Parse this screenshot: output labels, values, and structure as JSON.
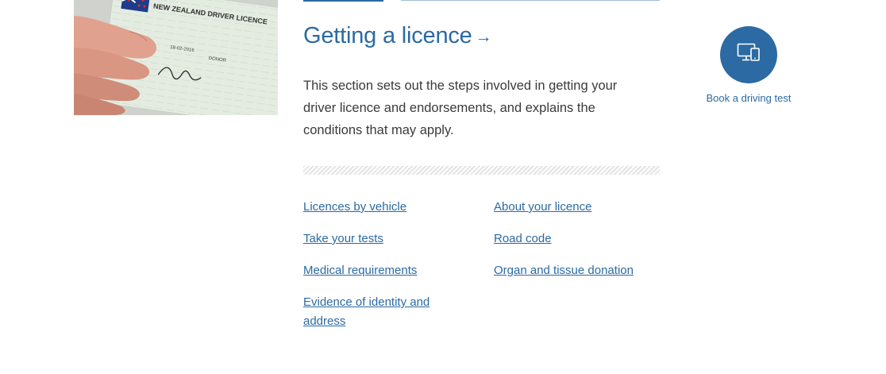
{
  "section": {
    "heading": "Getting a licence",
    "heading_arrow": "→",
    "intro": "This section sets out the steps involved in getting your driver licence and endorsements, and explains the conditions that may apply."
  },
  "hero_image": {
    "card_text": "NEW ZEALAND DRIVER LICENCE",
    "card_date": "18-02-2016",
    "card_donor": "DONOR"
  },
  "links": {
    "left": [
      "Licences by vehicle",
      "Take your tests",
      "Medical requirements",
      "Evidence of identity and address"
    ],
    "right": [
      "About your licence",
      "Road code",
      "Organ and tissue donation"
    ]
  },
  "book": {
    "label": "Book a driving test",
    "icon": "devices-icon"
  },
  "colors": {
    "accent": "#2b6aa3",
    "text": "#3a3a3a"
  }
}
